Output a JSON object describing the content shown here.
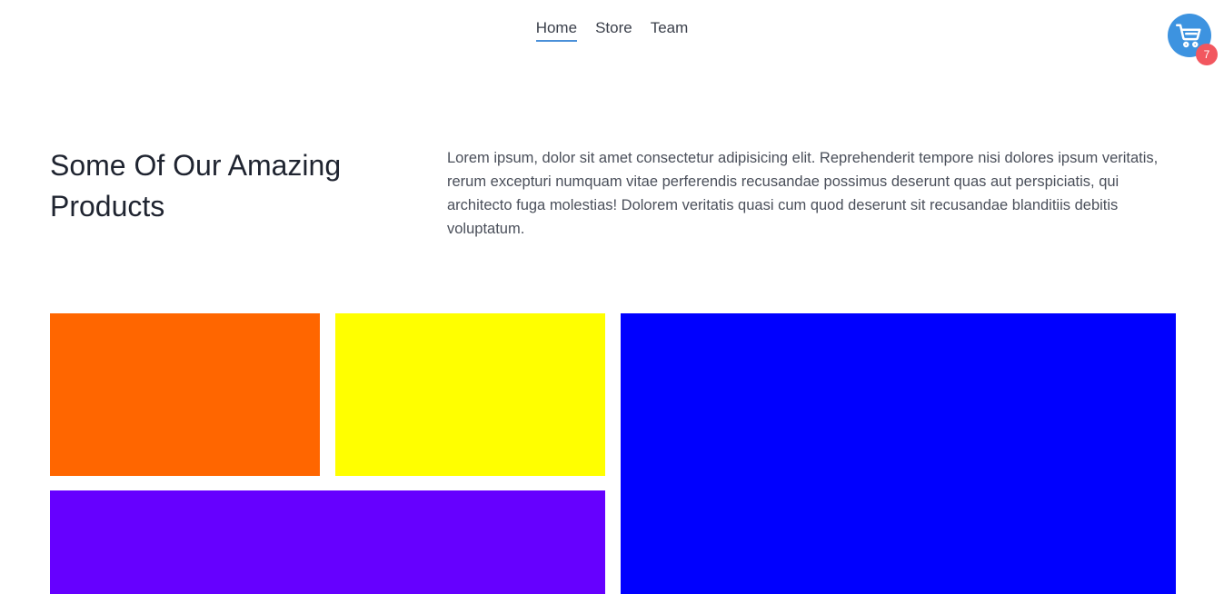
{
  "nav": {
    "items": [
      {
        "label": "Home",
        "active": true
      },
      {
        "label": "Store",
        "active": false
      },
      {
        "label": "Team",
        "active": false
      }
    ],
    "active_color": "#4a90d9"
  },
  "cart": {
    "icon": "shopping-cart-icon",
    "count": "7",
    "color": "#3d93e0",
    "badge_color": "#f2575f"
  },
  "hero": {
    "title": "Some Of Our Amazing Products",
    "description": "Lorem ipsum, dolor sit amet consectetur adipisicing elit. Reprehenderit tempore nisi dolores ipsum veritatis, rerum excepturi numquam vitae perferendis recusandae possimus deserunt quas aut perspiciatis, qui architecto fuga molestias! Dolorem veritatis quasi cum quod deserunt sit recusandae blanditiis debitis voluptatum."
  },
  "products": [
    {
      "color": "#ff6600"
    },
    {
      "color": "#ffff00"
    },
    {
      "color": "#0000ff"
    },
    {
      "color": "#6600ff"
    }
  ]
}
